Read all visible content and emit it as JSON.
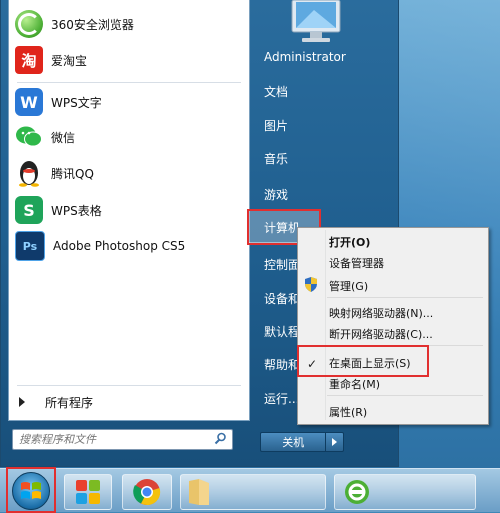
{
  "start_menu": {
    "programs": [
      {
        "label": "360安全浏览器",
        "icon": "360-browser-icon",
        "color": "#4caf35"
      },
      {
        "label": "爱淘宝",
        "icon": "taobao-icon",
        "color": "#e0251b"
      },
      {
        "label": "WPS文字",
        "icon": "wps-writer-icon",
        "color": "#2a78d6"
      },
      {
        "label": "微信",
        "icon": "wechat-icon",
        "color": "#2fb84a"
      },
      {
        "label": "腾讯QQ",
        "icon": "qq-penguin-icon",
        "color": "#222222"
      },
      {
        "label": "WPS表格",
        "icon": "wps-spreadsheet-icon",
        "color": "#1fa45a"
      },
      {
        "label": "Adobe Photoshop CS5",
        "icon": "photoshop-icon",
        "color": "#0f3a6b"
      }
    ],
    "all_programs_label": "所有程序",
    "search_placeholder": "搜索程序和文件",
    "right_items": [
      "Administrator",
      "文档",
      "图片",
      "音乐",
      "游戏",
      "计算机",
      "控制面",
      "设备和",
      "默认程",
      "帮助和",
      "运行..."
    ],
    "shutdown_label": "关机"
  },
  "context_menu": {
    "items": [
      "打开(O)",
      "设备管理器",
      "管理(G)",
      "映射网络驱动器(N)...",
      "断开网络驱动器(C)...",
      "在桌面上显示(S)",
      "重命名(M)",
      "属性(R)"
    ],
    "checked_item": "在桌面上显示(S)"
  },
  "taskbar": {
    "pinned": [
      "start-orb",
      "windows-store-icon",
      "chrome-icon",
      "folder-icon",
      "360-browser-icon"
    ]
  },
  "colors": {
    "highlight_red": "#e12f2f",
    "menu_blue": "#1f5e8e"
  }
}
